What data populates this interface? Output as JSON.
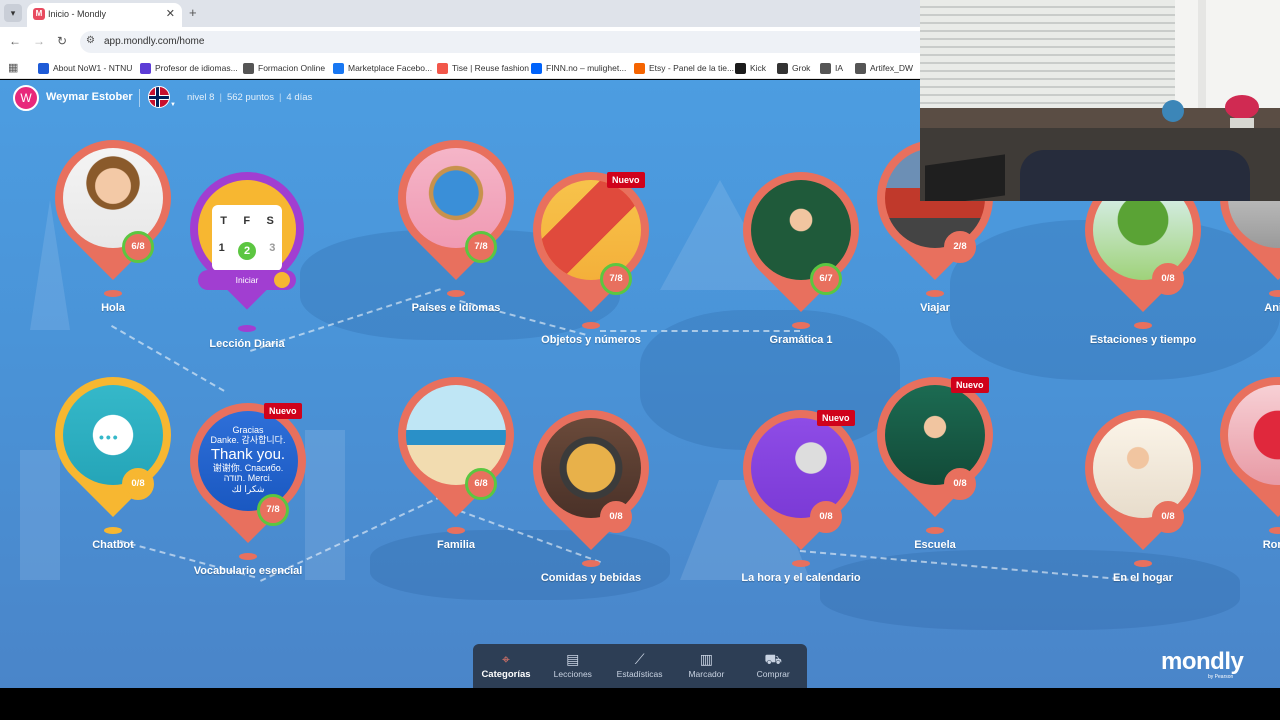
{
  "browser": {
    "tab_title": "Inicio - Mondly",
    "url": "app.mondly.com/home",
    "bookmarks": [
      {
        "label": "About NoW1 - NTNU",
        "icon": "youtube-icon",
        "color": "#1e5bd7"
      },
      {
        "label": "Profesor de idiomas...",
        "icon": "tutor-icon",
        "color": "#5c3cd6"
      },
      {
        "label": "Formacion Online",
        "icon": "folder-icon",
        "color": "#555555"
      },
      {
        "label": "Marketplace Facebo...",
        "icon": "facebook-icon",
        "color": "#1877f2"
      },
      {
        "label": "Tise | Reuse fashion",
        "icon": "tise-icon",
        "color": "#f2574a"
      },
      {
        "label": "FINN.no – mulighet...",
        "icon": "finn-icon",
        "color": "#0063fb"
      },
      {
        "label": "Etsy - Panel de la tie...",
        "icon": "etsy-icon",
        "color": "#f56400"
      },
      {
        "label": "Kick",
        "icon": "kick-icon",
        "color": "#1b1b1b"
      },
      {
        "label": "Grok",
        "icon": "grok-icon",
        "color": "#333333"
      },
      {
        "label": "IA",
        "icon": "folder-icon",
        "color": "#555555"
      },
      {
        "label": "Artifex_DW",
        "icon": "folder-icon",
        "color": "#555555"
      }
    ]
  },
  "user": {
    "initial": "W",
    "name": "Weymar Estober",
    "level": "nivel 8",
    "points": "562 puntos",
    "streak": "4 días",
    "flag": "norway-flag-icon"
  },
  "daily": {
    "label": "Lección Diaria",
    "days": [
      "T",
      "F",
      "S"
    ],
    "numbers": [
      "1",
      "2",
      "3"
    ],
    "start": "Iniciar"
  },
  "categories": [
    {
      "label": "Hola",
      "progress": "6/8",
      "done": true,
      "art": "woman-portrait",
      "new": ""
    },
    {
      "label": "Países e Idiomas",
      "progress": "7/8",
      "done": true,
      "art": "globe",
      "new": ""
    },
    {
      "label": "Objetos y números",
      "progress": "7/8",
      "done": true,
      "art": "objects",
      "new": "Nuevo"
    },
    {
      "label": "Gramática 1",
      "progress": "6/7",
      "done": true,
      "art": "teacher",
      "new": ""
    },
    {
      "label": "Viajar",
      "progress": "2/8",
      "done": false,
      "art": "train",
      "new": ""
    },
    {
      "label": "Estaciones y tiempo",
      "progress": "0/8",
      "done": false,
      "art": "tree",
      "new": ""
    },
    {
      "label": "Anim",
      "progress": "",
      "done": false,
      "art": "animal",
      "new": ""
    },
    {
      "label": "Chatbot",
      "progress": "0/8",
      "done": false,
      "art": "chat",
      "new": ""
    },
    {
      "label": "Vocabulario esencial",
      "progress": "7/8",
      "done": true,
      "art": "words",
      "new": "Nuevo"
    },
    {
      "label": "Familia",
      "progress": "6/8",
      "done": true,
      "art": "beach-family",
      "new": ""
    },
    {
      "label": "Comidas y bebidas",
      "progress": "0/8",
      "done": false,
      "art": "soup",
      "new": ""
    },
    {
      "label": "La hora y el calendario",
      "progress": "0/8",
      "done": false,
      "art": "clock",
      "new": "Nuevo"
    },
    {
      "label": "Escuela",
      "progress": "0/8",
      "done": false,
      "art": "school-teacher",
      "new": "Nuevo"
    },
    {
      "label": "En el hogar",
      "progress": "0/8",
      "done": false,
      "art": "cooking",
      "new": ""
    },
    {
      "label": "Roma",
      "progress": "",
      "done": false,
      "art": "hearts",
      "new": ""
    }
  ],
  "vocab_words": [
    "Gracias",
    "Danke. 감사합니다.",
    "Thank you.",
    "谢谢你. Спасибо.",
    "תודה. Merci.",
    "شكرا لك"
  ],
  "nav": [
    {
      "label": "Categorías",
      "icon": "map-pin-icon",
      "active": true
    },
    {
      "label": "Lecciones",
      "icon": "lessons-icon",
      "active": false
    },
    {
      "label": "Estadísticas",
      "icon": "chart-line-icon",
      "active": false
    },
    {
      "label": "Marcador",
      "icon": "leaderboard-icon",
      "active": false
    },
    {
      "label": "Comprar",
      "icon": "cart-icon",
      "active": false
    }
  ],
  "brand": {
    "name": "mondly",
    "sub": "by Pearson"
  }
}
